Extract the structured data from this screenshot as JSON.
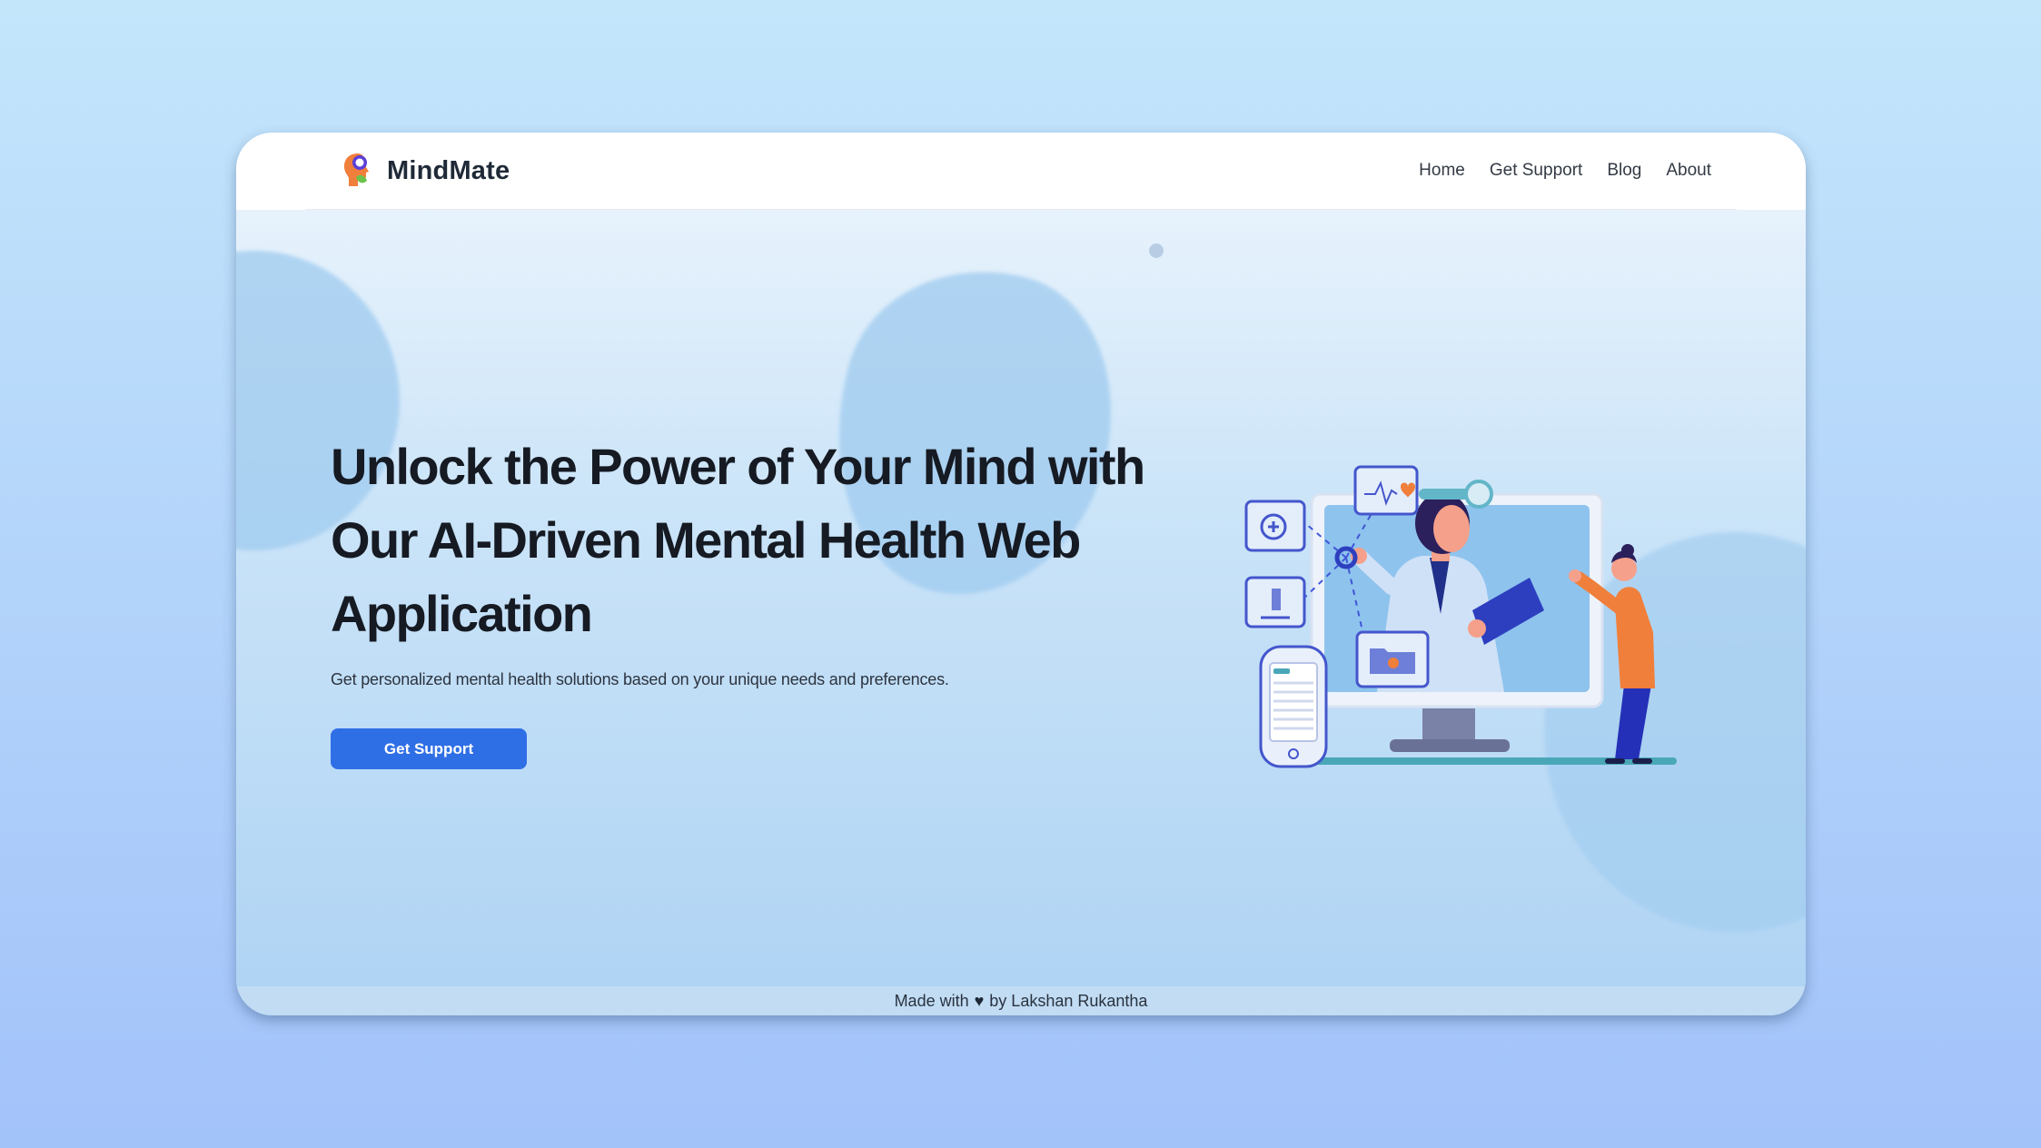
{
  "brand": {
    "name": "MindMate"
  },
  "nav": {
    "items": [
      "Home",
      "Get Support",
      "Blog",
      "About"
    ]
  },
  "hero": {
    "title": "Unlock the Power of Your Mind with Our AI-Driven Mental Health Web Application",
    "subtitle": "Get personalized mental health solutions based on your unique needs and preferences.",
    "cta_label": "Get Support"
  },
  "footer": {
    "prefix": "Made with",
    "heart": "♥",
    "suffix": "by Lakshan Rukantha"
  },
  "colors": {
    "accent": "#2f6fe6",
    "text_dark": "#161a22",
    "illustration_orange": "#f07f3b",
    "illustration_blue": "#2d3fbf"
  }
}
